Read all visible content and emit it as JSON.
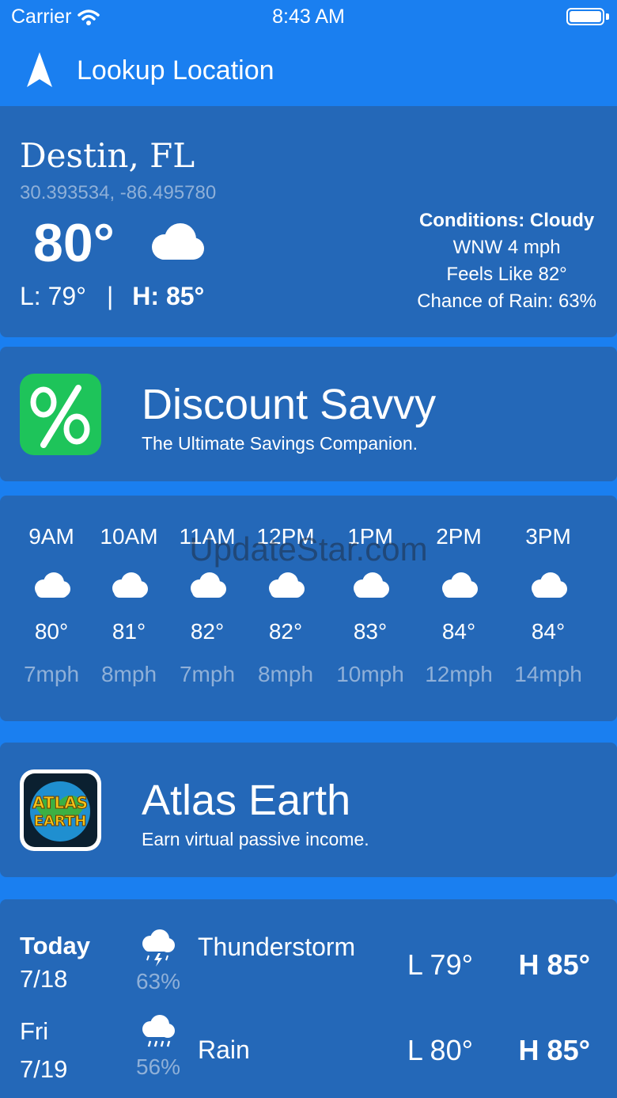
{
  "status_bar": {
    "carrier": "Carrier",
    "time": "8:43 AM"
  },
  "nav": {
    "title": "Lookup Location",
    "icon": "location-arrow-icon"
  },
  "current": {
    "city": "Destin, FL",
    "coords": "30.393534, -86.495780",
    "temp": "80°",
    "icon": "cloud-icon",
    "low": "L: 79°",
    "separator": "|",
    "high": "H: 85°",
    "conditions": "Conditions: Cloudy",
    "wind": "WNW 4 mph",
    "feels_like": "Feels Like 82°",
    "rain_chance": "Chance of Rain: 63%"
  },
  "ads": [
    {
      "title": "Discount Savvy",
      "subtitle": "The Ultimate Savings Companion.",
      "icon": "percent-icon",
      "icon_color": "#1ec45a"
    },
    {
      "title": "Atlas Earth",
      "subtitle": "Earn virtual passive income.",
      "icon": "atlas-earth-logo-icon",
      "logo_lines": [
        "ATLAS",
        "EARTH"
      ]
    }
  ],
  "hourly": [
    {
      "time": "9AM",
      "temp": "80°",
      "wind": "7mph"
    },
    {
      "time": "10AM",
      "temp": "81°",
      "wind": "8mph"
    },
    {
      "time": "11AM",
      "temp": "82°",
      "wind": "7mph"
    },
    {
      "time": "12PM",
      "temp": "82°",
      "wind": "8mph"
    },
    {
      "time": "1PM",
      "temp": "83°",
      "wind": "10mph"
    },
    {
      "time": "2PM",
      "temp": "84°",
      "wind": "12mph"
    },
    {
      "time": "3PM",
      "temp": "84°",
      "wind": "14mph"
    }
  ],
  "watermark": "UpdateStar.com",
  "daily": [
    {
      "day": "Today",
      "date": "7/18",
      "icon": "thunderstorm-icon",
      "precip": "63%",
      "condition": "Thunderstorm",
      "low": "L 79°",
      "high": "H 85°"
    },
    {
      "day": "Fri",
      "date": "7/19",
      "icon": "rain-icon",
      "precip": "56%",
      "condition": "Rain",
      "low": "L 80°",
      "high": "H 85°"
    }
  ],
  "colors": {
    "background": "#1a7ff0",
    "card": "#2468b8",
    "muted_text": "#8fb0d8"
  }
}
